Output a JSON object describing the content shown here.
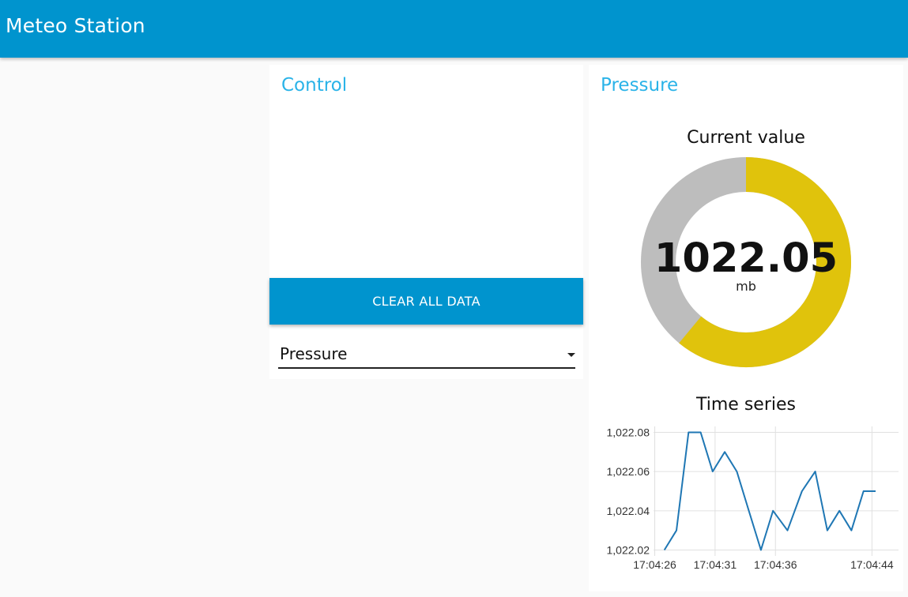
{
  "app": {
    "title": "Meteo Station"
  },
  "control": {
    "title": "Control",
    "clear_button_label": "CLEAR ALL DATA",
    "sensor_select": {
      "selected": "Pressure"
    }
  },
  "pressure": {
    "title": "Pressure",
    "gauge": {
      "title": "Current value",
      "value": "1022.05",
      "unit": "mb",
      "fill_fraction": 0.61,
      "fill_color": "#e0c30c",
      "track_color": "#bdbdbd"
    },
    "timeseries": {
      "title": "Time series"
    }
  },
  "chart_data": {
    "type": "line",
    "title": "Time series",
    "xlabel": "",
    "ylabel": "",
    "x_tick_labels": [
      "17:04:26",
      "17:04:31",
      "17:04:36",
      "17:04:44"
    ],
    "y_tick_labels": [
      "1,022.08",
      "1,022.06",
      "1,022.04",
      "1,022.02"
    ],
    "y_ticks": [
      1022.08,
      1022.06,
      1022.04,
      1022.02
    ],
    "x_ticks": [
      26,
      31,
      36,
      44
    ],
    "ylim": [
      1022.019,
      1022.083
    ],
    "xlim": [
      25.9,
      46.2
    ],
    "grid": true,
    "line_color": "#1f77b4",
    "series": [
      {
        "x": [
          26.8,
          27.8,
          28.8,
          29.8,
          30.8,
          31.8,
          32.8,
          33.8,
          34.8,
          35.8,
          37.0,
          38.2,
          39.3,
          40.3,
          41.3,
          42.3,
          43.3,
          44.3
        ],
        "values": [
          1022.02,
          1022.03,
          1022.08,
          1022.08,
          1022.06,
          1022.07,
          1022.06,
          1022.04,
          1022.02,
          1022.04,
          1022.03,
          1022.05,
          1022.06,
          1022.03,
          1022.04,
          1022.03,
          1022.05,
          1022.05
        ]
      }
    ]
  }
}
